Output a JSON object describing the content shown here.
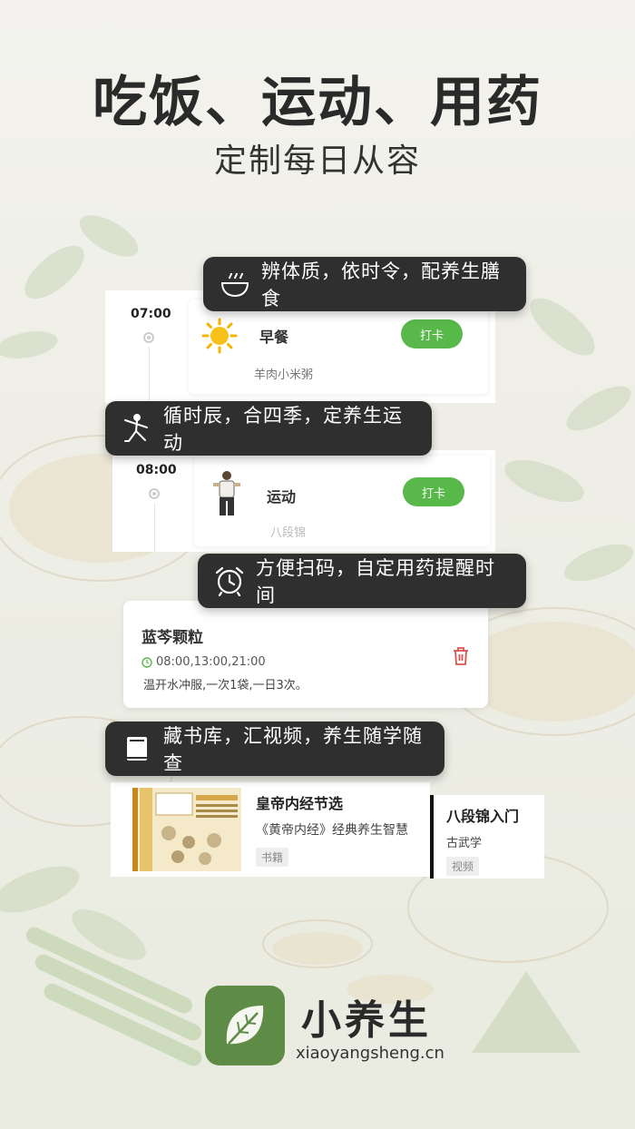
{
  "header": {
    "title": "吃饭、运动、用药",
    "subtitle": "定制每日从容"
  },
  "features": [
    {
      "icon": "bowl-icon",
      "text": "辨体质，依时令，配养生膳食"
    },
    {
      "icon": "taichi-figure-icon",
      "text": "循时辰，合四季，定养生运动"
    },
    {
      "icon": "alarm-clock-icon",
      "text": "方便扫码，自定用药提醒时间"
    },
    {
      "icon": "book-icon",
      "text": "藏书库，汇视频，养生随学随查"
    }
  ],
  "meal_card": {
    "time": "07:00",
    "icon": "sun-icon",
    "title": "早餐",
    "detail": "羊肉小米粥",
    "button": "打卡"
  },
  "exercise_card": {
    "time": "08:00",
    "icon": "exercise-figure-icon",
    "title": "运动",
    "detail": "八段锦",
    "button": "打卡"
  },
  "medicine_card": {
    "name": "蓝芩颗粒",
    "times": "08:00,13:00,21:00",
    "instructions": "温开水冲服,一次1袋,一日3次。",
    "delete_icon": "trash-icon"
  },
  "library": {
    "items": [
      {
        "title": "皇帝内经节选",
        "desc": "《黄帝内经》经典养生智慧",
        "tag": "书籍"
      },
      {
        "title": "八段锦入门",
        "desc": "古武学",
        "tag": "视频"
      }
    ]
  },
  "brand": {
    "name": "小养生",
    "url": "xiaoyangsheng.cn",
    "logo_icon": "leaf-icon"
  },
  "colors": {
    "accent_green": "#58b84a",
    "pill_bg": "#2f2f2f",
    "logo_green": "#5e8c47",
    "delete_red": "#d9534f"
  }
}
